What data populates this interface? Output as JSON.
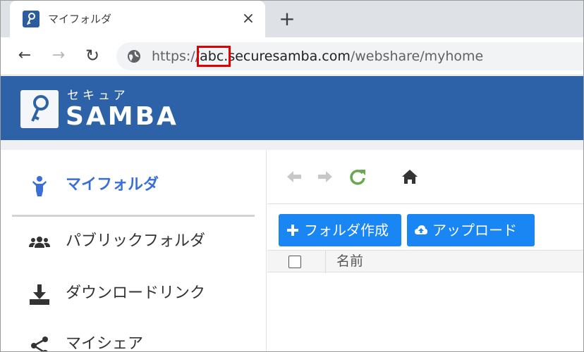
{
  "browser": {
    "tab_title": "マイフォルダ",
    "tab_close_label": "×",
    "new_tab_label": "+",
    "url_prefix": "https://",
    "url_highlight": "abc.",
    "url_domain": "securesamba.com",
    "url_path": "/webshare/myhome"
  },
  "brand": {
    "kana": "セキュア",
    "wordmark": "SAMBA",
    "header_color": "#2d62a8"
  },
  "sidebar": {
    "items": [
      {
        "label": "マイフォルダ",
        "icon": "person-icon",
        "active": true
      },
      {
        "label": "パブリックフォルダ",
        "icon": "users-icon",
        "active": false
      },
      {
        "label": "ダウンロードリンク",
        "icon": "download-icon",
        "active": false
      },
      {
        "label": "マイシェア",
        "icon": "share-icon",
        "active": false
      }
    ]
  },
  "main": {
    "create_folder_label": "フォルダ作成",
    "upload_label": "アップロード",
    "column_name": "名前",
    "button_color": "#1a86f4"
  }
}
